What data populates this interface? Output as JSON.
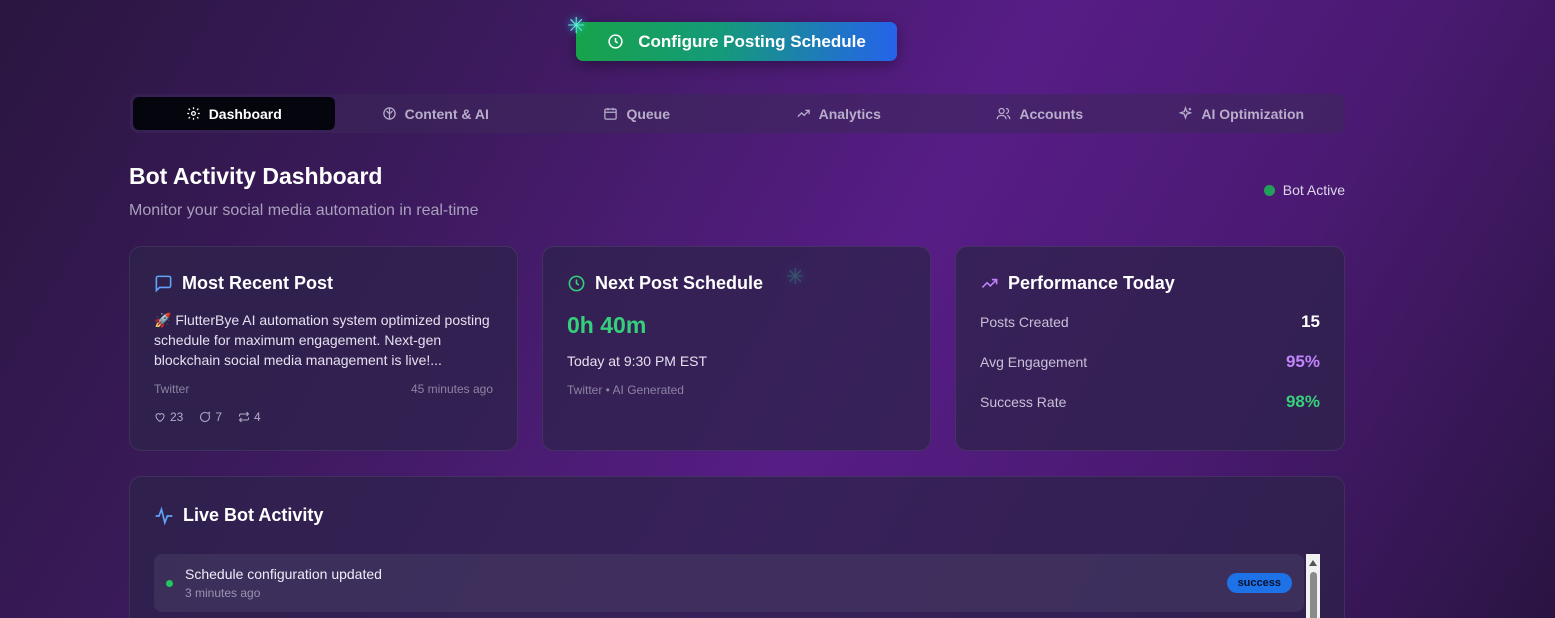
{
  "header": {
    "configure_button": "Configure Posting Schedule",
    "configure_icon": "clock-icon"
  },
  "tabs": [
    {
      "label": "Dashboard",
      "icon": "gear-icon",
      "active": true
    },
    {
      "label": "Content & AI",
      "icon": "brain-icon",
      "active": false
    },
    {
      "label": "Queue",
      "icon": "calendar-icon",
      "active": false
    },
    {
      "label": "Analytics",
      "icon": "trending-up-icon",
      "active": false
    },
    {
      "label": "Accounts",
      "icon": "users-icon",
      "active": false
    },
    {
      "label": "AI Optimization",
      "icon": "sparkles-icon",
      "active": false
    }
  ],
  "dashboard": {
    "title": "Bot Activity Dashboard",
    "subtitle": "Monitor your social media automation in real-time",
    "status": "Bot Active"
  },
  "recent_post": {
    "title": "Most Recent Post",
    "text": "🚀 FlutterBye AI automation system optimized posting schedule for maximum engagement. Next-gen blockchain social media management is live!...",
    "platform": "Twitter",
    "time": "45 minutes ago",
    "likes": "23",
    "comments": "7",
    "retweets": "4"
  },
  "next_post": {
    "title": "Next Post Schedule",
    "countdown": "0h 40m",
    "time": "Today at 9:30 PM EST",
    "meta": "Twitter • AI Generated"
  },
  "performance": {
    "title": "Performance Today",
    "rows": [
      {
        "label": "Posts Created",
        "value": "15"
      },
      {
        "label": "Avg Engagement",
        "value": "95%"
      },
      {
        "label": "Success Rate",
        "value": "98%"
      }
    ]
  },
  "activity": {
    "title": "Live Bot Activity",
    "items": [
      {
        "title": "Schedule configuration updated",
        "time": "3 minutes ago",
        "badge": "success"
      }
    ]
  },
  "colors": {
    "accent_green": "#34d07a",
    "accent_purple": "#c084fc",
    "badge_blue": "#1d72e8"
  }
}
